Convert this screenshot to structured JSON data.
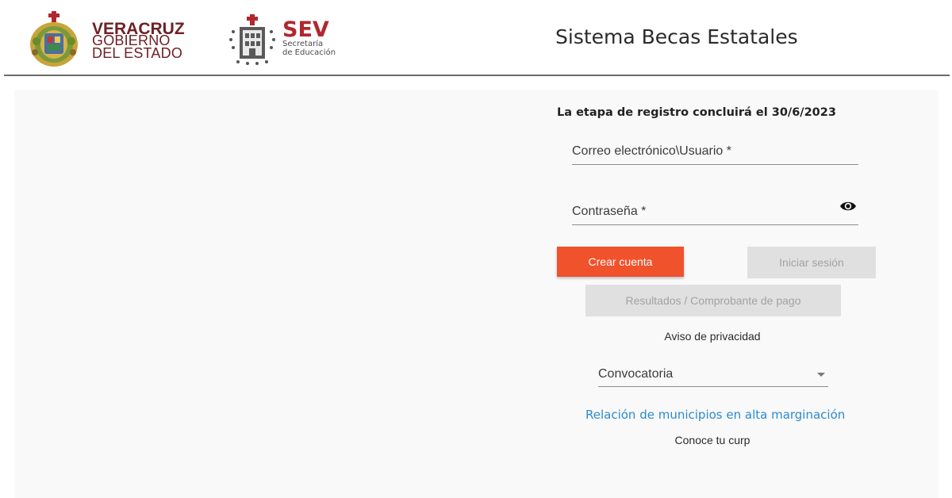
{
  "header": {
    "veracruz": {
      "line1": "VERACRUZ",
      "line2": "GOBIERNO",
      "line3": "DEL ESTADO"
    },
    "sev": {
      "title": "SEV",
      "subtitle1": "Secretaría",
      "subtitle2": "de Educación"
    },
    "app_title": "Sistema Becas Estatales"
  },
  "form": {
    "stage_note": "La etapa de registro concluirá el 30/6/2023",
    "email_label": "Correo electrónico\\Usuario *",
    "password_label": "Contraseña *",
    "create_account": "Crear cuenta",
    "login": "Iniciar sesión",
    "results": "Resultados / Comprobante de pago",
    "privacy": "Aviso de privacidad",
    "convocatoria": "Convocatoria",
    "municipios_link": "Relación de municipios en alta marginación",
    "curp": "Conoce tu curp"
  },
  "icons": {
    "password_toggle": "eye-icon",
    "select_caret": "caret-down-icon",
    "veracruz_logo": "veracruz-coat-of-arms-icon",
    "sev_logo": "sev-building-icon"
  },
  "colors": {
    "primary_button": "#f0522c",
    "disabled_button": "#e0e0e0",
    "link": "#2b8ad0",
    "brand_red": "#6d2126"
  }
}
